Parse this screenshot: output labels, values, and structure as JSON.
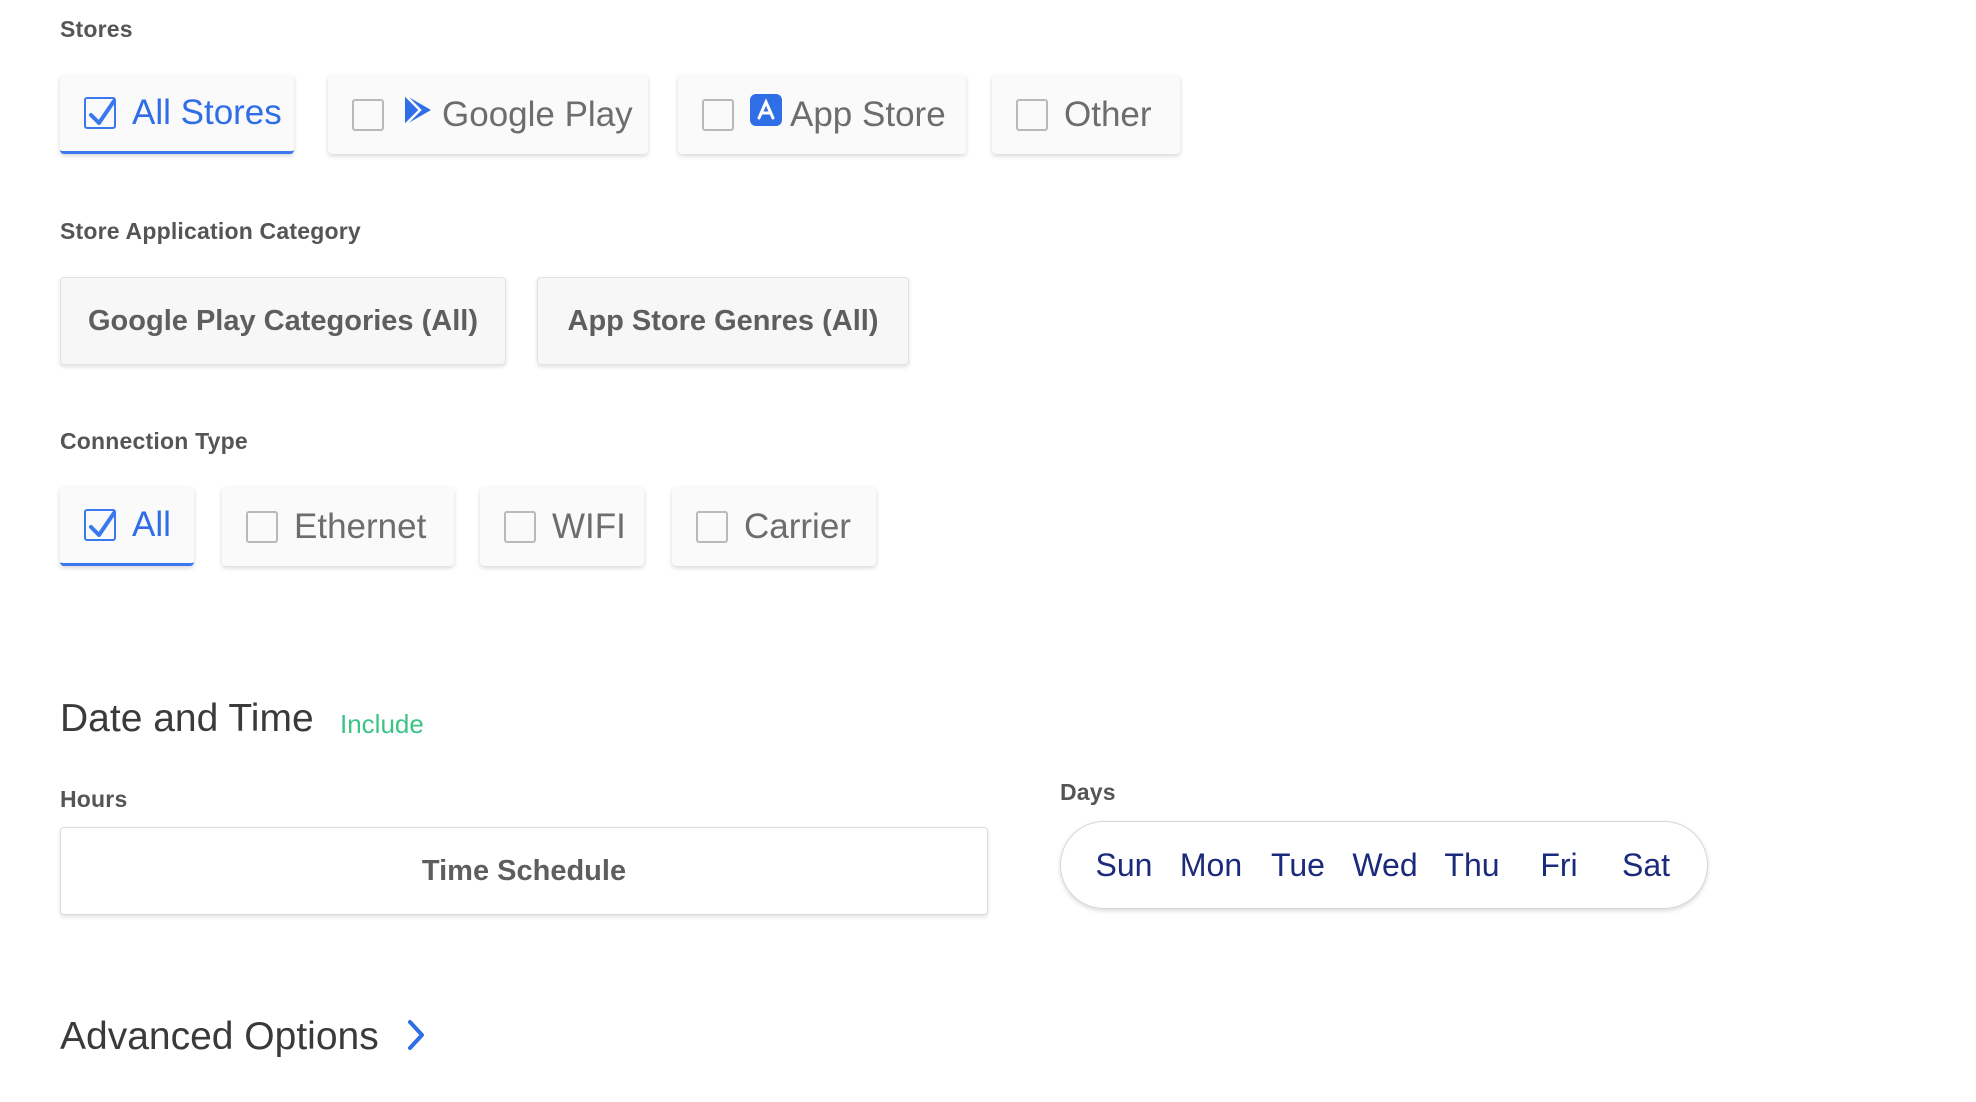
{
  "stores": {
    "label": "Stores",
    "options": [
      {
        "label": "All Stores",
        "checked": true,
        "icon": "checkbox-checked"
      },
      {
        "label": "Google Play",
        "checked": false,
        "icon": "google-play-icon"
      },
      {
        "label": "App Store",
        "checked": false,
        "icon": "app-store-icon"
      },
      {
        "label": "Other",
        "checked": false
      }
    ]
  },
  "category": {
    "label": "Store Application Category",
    "buttons": [
      {
        "label": "Google Play Categories (All)"
      },
      {
        "label": "App Store Genres (All)"
      }
    ]
  },
  "connection": {
    "label": "Connection Type",
    "options": [
      {
        "label": "All",
        "checked": true
      },
      {
        "label": "Ethernet",
        "checked": false
      },
      {
        "label": "WIFI",
        "checked": false
      },
      {
        "label": "Carrier",
        "checked": false
      }
    ]
  },
  "date_time": {
    "title": "Date and Time",
    "include_label": "Include",
    "hours_label": "Hours",
    "time_schedule_label": "Time Schedule",
    "days_label": "Days",
    "days": [
      "Sun",
      "Mon",
      "Tue",
      "Wed",
      "Thu",
      "Fri",
      "Sat"
    ]
  },
  "advanced": {
    "label": "Advanced Options",
    "icon": "chevron-right-icon"
  },
  "colors": {
    "accent_blue": "#3a78f0",
    "include_green": "#3cc487",
    "day_navy": "#1b2a7a"
  }
}
